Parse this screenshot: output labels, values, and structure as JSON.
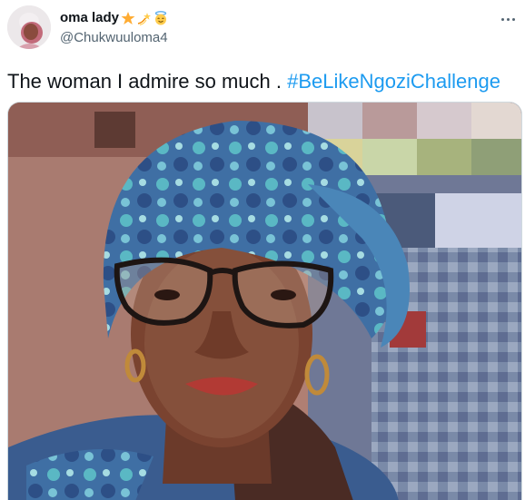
{
  "tweet": {
    "author": {
      "display_name": "oma lady",
      "badges": [
        "star-emoji",
        "dizzy-emoji",
        "angel-emoji"
      ],
      "handle": "@Chukwuuloma4",
      "avatar_icon": "profile-avatar"
    },
    "more_icon": "more-horizontal-icon",
    "text": "The woman I admire so much . ",
    "hashtag": "#BeLikeNgoziChallenge",
    "media": {
      "description_icon": "selfie-photo",
      "has_pixelated_region": true
    }
  },
  "colors": {
    "link": "#1d9bf0",
    "text_primary": "#0f1419",
    "text_secondary": "#536471",
    "border": "#cfd9de"
  }
}
